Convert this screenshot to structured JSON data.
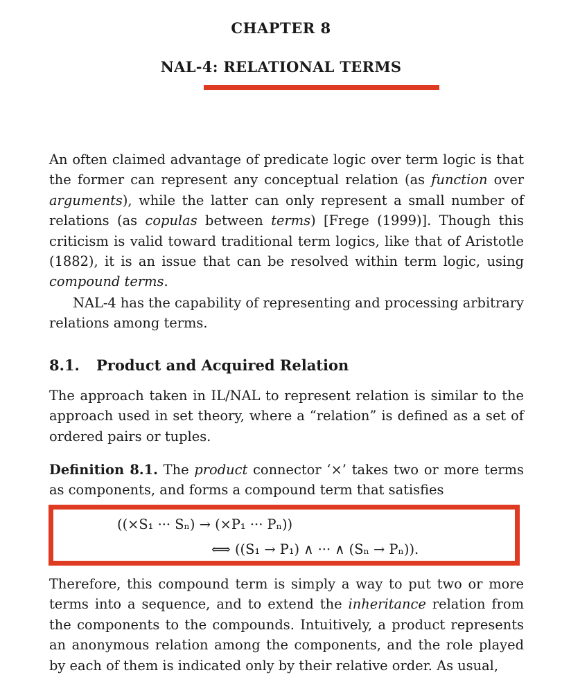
{
  "chapter": {
    "label": "CHAPTER 8",
    "title": "NAL-4: RELATIONAL TERMS"
  },
  "intro": {
    "p1": [
      "An often claimed advantage of predicate logic over term logic is that the former can represent any conceptual relation (as ",
      "function",
      " over ",
      "arguments",
      "), while the latter can only represent a small number of relations (as ",
      "copulas",
      " between ",
      "terms",
      ") [Frege (1999)]. Though this criticism is valid toward traditional term logics, like that of Aristotle (1882), it is an issue that can be resolved within term logic, using ",
      "compound terms",
      "."
    ],
    "p2": "NAL-4 has the capability of representing and processing arbitrary relations among terms."
  },
  "section": {
    "number": "8.1.",
    "title": "Product and Acquired Relation",
    "p1": "The approach taken in IL/NAL to represent relation is similar to the approach used in set theory, where a “relation” is defined as a set of ordered pairs or tuples."
  },
  "definition": {
    "label": "Definition 8.1.",
    "text_before": "The ",
    "product_word": "product",
    "text_after": " connector ‘×’ takes two or more terms as components, and forms a compound term that satisfies",
    "formula_line1": "((×S₁ ··· Sₙ)  →  (×P₁ ··· Pₙ))",
    "formula_line2": "⟺ ((S₁ → P₁) ∧ ··· ∧ (Sₙ → Pₙ))."
  },
  "after": {
    "text_before": "Therefore, this compound term is simply a way to put two or more terms into a sequence, and to extend the ",
    "inheritance_word": "inheritance",
    "text_after": " relation from the components to the compounds. Intuitively, a product represents an anonymous relation among the components, and the role played by each of them is indicated only by their relative order. As usual,"
  },
  "colors": {
    "highlight": "#de3b22",
    "text": "#1a1a1a"
  }
}
